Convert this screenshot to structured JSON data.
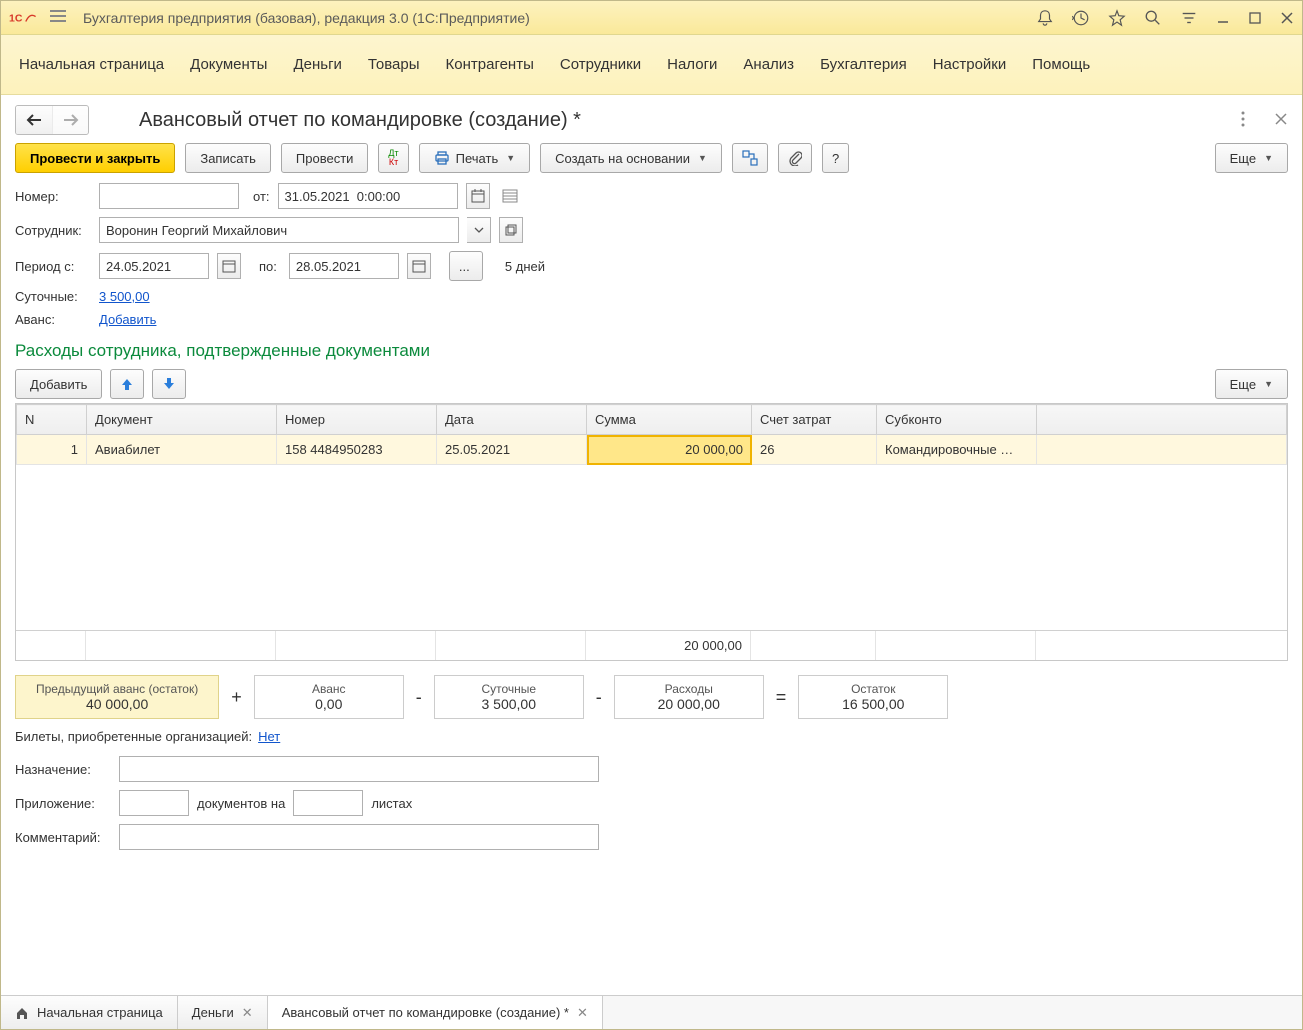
{
  "window": {
    "title": "Бухгалтерия предприятия (базовая), редакция 3.0  (1С:Предприятие)"
  },
  "menu": [
    "Начальная страница",
    "Документы",
    "Деньги",
    "Товары",
    "Контрагенты",
    "Сотрудники",
    "Налоги",
    "Анализ",
    "Бухгалтерия",
    "Настройки",
    "Помощь"
  ],
  "page": {
    "title": "Авансовый отчет по командировке (создание) *"
  },
  "toolbar": {
    "post_close": "Провести и закрыть",
    "save": "Записать",
    "post": "Провести",
    "print": "Печать",
    "create_based": "Создать на основании",
    "help": "?",
    "more": "Еще"
  },
  "form": {
    "number_label": "Номер:",
    "number_value": "",
    "from_label": "от:",
    "from_value": "31.05.2021  0:00:00",
    "employee_label": "Сотрудник:",
    "employee_value": "Воронин Георгий Михайлович",
    "period_from_label": "Период с:",
    "period_from_value": "24.05.2021",
    "period_to_label": "по:",
    "period_to_value": "28.05.2021",
    "days_text": "5 дней",
    "per_diem_label": "Суточные:",
    "per_diem_value": "3 500,00",
    "advance_label": "Аванс:",
    "advance_link": "Добавить"
  },
  "section": {
    "title": "Расходы сотрудника, подтвержденные документами"
  },
  "table_toolbar": {
    "add": "Добавить",
    "more": "Еще"
  },
  "table": {
    "headers": [
      "N",
      "Документ",
      "Номер",
      "Дата",
      "Сумма",
      "Счет затрат",
      "Субконто",
      ""
    ],
    "rows": [
      {
        "n": "1",
        "doc": "Авиабилет",
        "num": "158 4484950283",
        "date": "25.05.2021",
        "sum": "20 000,00",
        "acc": "26",
        "sub": "Командировочные …"
      }
    ],
    "footer_sum": "20 000,00"
  },
  "summary": {
    "prev_advance": {
      "t": "Предыдущий аванс (остаток)",
      "v": "40 000,00"
    },
    "advance": {
      "t": "Аванс",
      "v": "0,00"
    },
    "per_diem": {
      "t": "Суточные",
      "v": "3 500,00"
    },
    "expenses": {
      "t": "Расходы",
      "v": "20 000,00"
    },
    "balance": {
      "t": "Остаток",
      "v": "16 500,00"
    }
  },
  "tickets": {
    "label": "Билеты, приобретенные организацией:",
    "link": "Нет"
  },
  "bottom": {
    "purpose_label": "Назначение:",
    "attach_label": "Приложение:",
    "attach_mid": "документов на",
    "attach_tail": "листах",
    "comment_label": "Комментарий:"
  },
  "tabs": [
    {
      "label": "Начальная страница",
      "closable": false,
      "icon": "home"
    },
    {
      "label": "Деньги",
      "closable": true
    },
    {
      "label": "Авансовый отчет по командировке (создание) *",
      "closable": true,
      "active": true
    }
  ]
}
